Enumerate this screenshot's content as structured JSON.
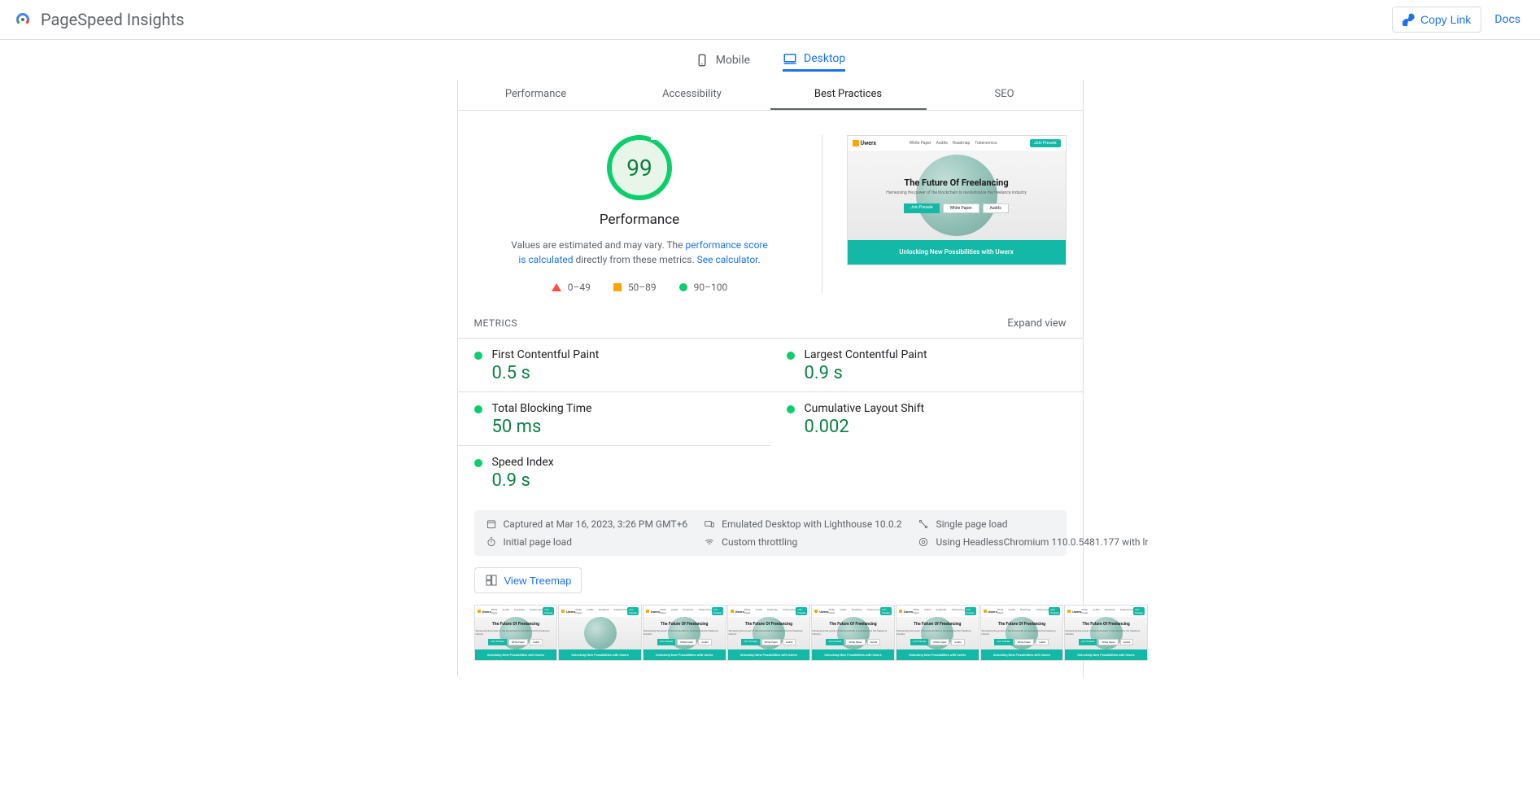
{
  "header": {
    "title": "PageSpeed Insights",
    "copy_link": "Copy Link",
    "docs": "Docs"
  },
  "device_tabs": {
    "mobile": "Mobile",
    "desktop": "Desktop",
    "active": "desktop"
  },
  "category_tabs": {
    "performance": "Performance",
    "accessibility": "Accessibility",
    "best_practices": "Best Practices",
    "seo": "SEO",
    "active": "best_practices"
  },
  "gauge": {
    "score": "99",
    "label": "Performance",
    "desc_prefix": "Values are estimated and may vary. The ",
    "desc_link1": "performance score is calculated",
    "desc_mid": " directly from these metrics. ",
    "desc_link2": "See calculator.",
    "legend": {
      "bad": "0–49",
      "mid": "50–89",
      "good": "90–100"
    }
  },
  "screenshot": {
    "brand": "Uwerx",
    "nav": [
      "White Paper",
      "Audits",
      "Roadmap",
      "Tokenomics"
    ],
    "cta": "Join Presale",
    "hero_title": "The Future Of Freelancing",
    "hero_sub": "Harnessing the power of the blockchain to revolutionize the freelance industry",
    "hero_btns": [
      "Join Presale",
      "White Paper",
      "Audits"
    ],
    "footer": "Unlocking New Possibilities with Uwerx"
  },
  "metrics": {
    "title": "METRICS",
    "expand": "Expand view",
    "items": [
      {
        "name": "First Contentful Paint",
        "value": "0.5 s"
      },
      {
        "name": "Largest Contentful Paint",
        "value": "0.9 s"
      },
      {
        "name": "Total Blocking Time",
        "value": "50 ms"
      },
      {
        "name": "Cumulative Layout Shift",
        "value": "0.002"
      },
      {
        "name": "Speed Index",
        "value": "0.9 s"
      }
    ]
  },
  "env": {
    "captured": "Captured at Mar 16, 2023, 3:26 PM GMT+6",
    "emulated": "Emulated Desktop with Lighthouse 10.0.2",
    "load_type": "Single page load",
    "initial": "Initial page load",
    "throttling": "Custom throttling",
    "browser": "Using HeadlessChromium 110.0.5481.177 with lr"
  },
  "treemap": {
    "label": "View Treemap"
  }
}
